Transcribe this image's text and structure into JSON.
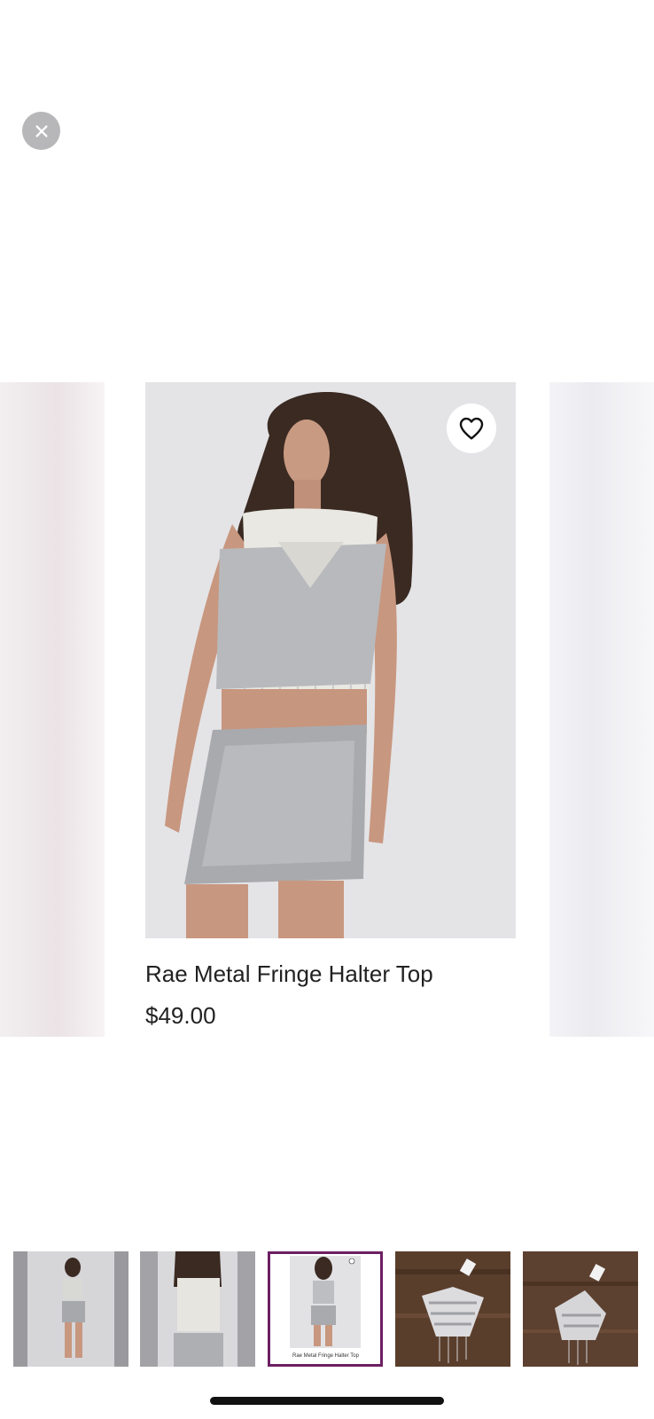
{
  "overlay": {
    "close_icon": "close-icon"
  },
  "product": {
    "title": "Rae Metal Fringe Halter Top",
    "price": "$49.00",
    "favorite_icon": "heart-outline-icon"
  },
  "thumbnails": [
    {
      "alt": "model front view",
      "selected": false,
      "caption": ""
    },
    {
      "alt": "model back view",
      "selected": false,
      "caption": ""
    },
    {
      "alt": "product card",
      "selected": true,
      "caption": "Rae Metal Fringe Halter Top"
    },
    {
      "alt": "flat lay on wood",
      "selected": false,
      "caption": ""
    },
    {
      "alt": "flat lay close-up",
      "selected": false,
      "caption": ""
    }
  ],
  "colors": {
    "selected_border": "#6d1f63",
    "close_button_bg": "#b7b7b9",
    "text": "#222222"
  }
}
